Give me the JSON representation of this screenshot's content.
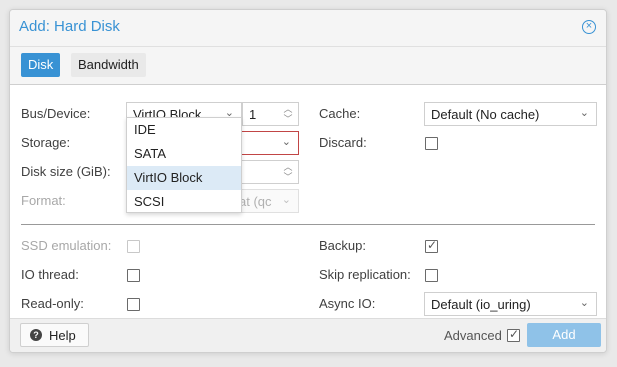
{
  "dialog": {
    "title": "Add: Hard Disk"
  },
  "tabs": [
    {
      "label": "Disk"
    },
    {
      "label": "Bandwidth"
    }
  ],
  "left": {
    "bus_device_label": "Bus/Device:",
    "bus_value": "VirtIO Block",
    "device_index": "1",
    "storage_label": "Storage:",
    "disk_size_label": "Disk size (GiB):",
    "format_label": "Format:",
    "format_value": "at (qc",
    "bus_options": [
      "IDE",
      "SATA",
      "VirtIO Block",
      "SCSI"
    ]
  },
  "right": {
    "cache_label": "Cache:",
    "cache_value": "Default (No cache)",
    "discard_label": "Discard:"
  },
  "options": {
    "ssd_label": "SSD emulation:",
    "iothread_label": "IO thread:",
    "readonly_label": "Read-only:",
    "backup_label": "Backup:",
    "skip_replication_label": "Skip replication:",
    "async_io_label": "Async IO:",
    "async_io_value": "Default (io_uring)"
  },
  "footer": {
    "help_label": "Help",
    "advanced_label": "Advanced",
    "add_label": "Add"
  },
  "icons": {
    "close": "close-circle-icon",
    "help": "question-circle-icon",
    "check": "checkmark-icon",
    "caret": "chevron-down-icon"
  },
  "colors": {
    "accent": "#3892d4",
    "invalid_border": "#c14545",
    "selected_item": "#dceaf6",
    "disabled_button": "#8fc2e8"
  }
}
